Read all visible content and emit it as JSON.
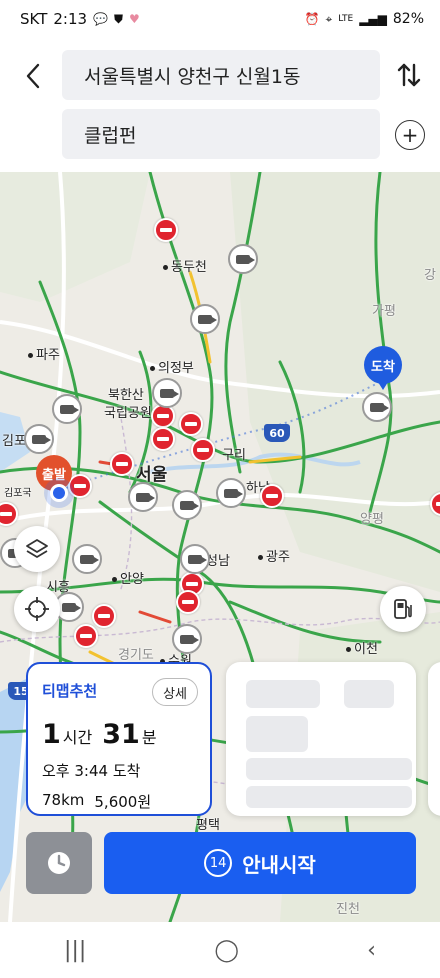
{
  "status": {
    "carrier": "SKT",
    "time": "2:13",
    "battery": "82%",
    "network": "LTE",
    "icons_left": [
      "chat-icon",
      "shield-icon",
      "heart-icon"
    ],
    "icons_right": [
      "alarm-icon",
      "location-icon",
      "signal-icon"
    ]
  },
  "search": {
    "start": "서울특별시 양천구 신월1동",
    "goal": "클럽펀",
    "icons": [
      "back-arrow-icon",
      "swap-icon",
      "add-waypoint-icon"
    ]
  },
  "map": {
    "places": [
      "동두천",
      "파주",
      "의정부",
      "북한산",
      "국립공원",
      "김포",
      "서울",
      "하남",
      "구리",
      "양평",
      "성남",
      "광주",
      "안양",
      "시흥",
      "이천",
      "경기도",
      "수원",
      "평택",
      "진천",
      "가평",
      "강"
    ],
    "shield_60": "60",
    "shield_15": "15",
    "start_marker": "출발",
    "dest_marker": "도착",
    "cut_label": "김포국"
  },
  "route_card": {
    "title": "티맵추천",
    "detail": "상세",
    "hours": "1",
    "hours_unit": "시간",
    "minutes": "31",
    "minutes_unit": "분",
    "arrival": "오후 3:44 도착",
    "distance": "78km",
    "fare": "5,600원"
  },
  "actions": {
    "countdown": "14",
    "start_label": "안내시작"
  },
  "colors": {
    "accent": "#1a5ef0",
    "traffic_green": "#3aa54a",
    "noentry_red": "#e0242f",
    "start_orange": "#e2512c"
  }
}
